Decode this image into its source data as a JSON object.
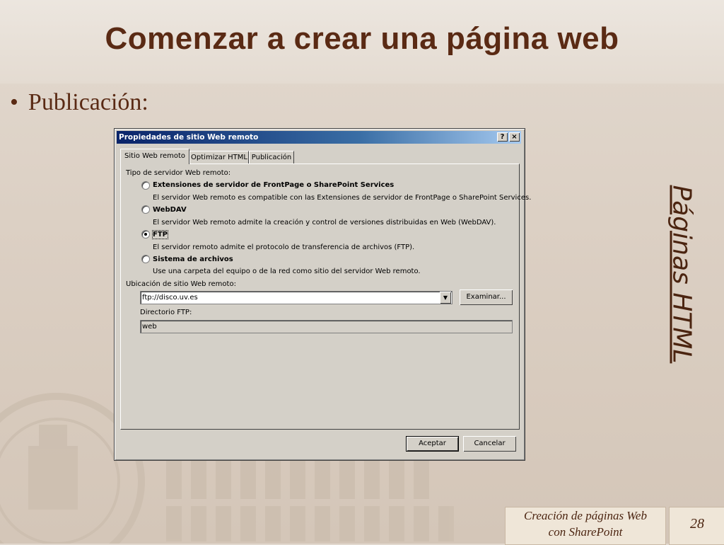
{
  "slide": {
    "title": "Comenzar a crear una página web",
    "bullet": "Publicación:",
    "side_title": "Páginas HTML",
    "footer_line1": "Creación de páginas Web",
    "footer_line2": "con SharePoint",
    "page_number": "28",
    "colors": {
      "title": "#5a2a14",
      "background": "#dcd0c4"
    }
  },
  "dialog": {
    "title": "Propiedades de sitio Web remoto",
    "help_btn": "?",
    "close_btn": "×",
    "tabs": [
      {
        "label": "Sitio Web remoto",
        "active": true
      },
      {
        "label": "Optimizar HTML",
        "active": false
      },
      {
        "label": "Publicación",
        "active": false
      }
    ],
    "server_type_label": "Tipo de servidor Web remoto:",
    "options": [
      {
        "label": "Extensiones de servidor de FrontPage o SharePoint Services",
        "desc": "El servidor Web remoto es compatible con las Extensiones de servidor de FrontPage o SharePoint Services.",
        "selected": false
      },
      {
        "label": "WebDAV",
        "desc": "El servidor Web remoto admite la creación y control de versiones distribuidas en Web (WebDAV).",
        "selected": false
      },
      {
        "label": "FTP",
        "desc": "El servidor remoto admite el protocolo de transferencia de archivos (FTP).",
        "selected": true
      },
      {
        "label": "Sistema de archivos",
        "desc": "Use una carpeta del equipo o de la red como sitio del servidor Web remoto.",
        "selected": false
      }
    ],
    "location_label": "Ubicación de sitio Web remoto:",
    "location_value": "ftp://disco.uv.es",
    "browse_button": "Examinar...",
    "ftp_dir_label": "Directorio FTP:",
    "ftp_dir_value": "web",
    "ok_button": "Aceptar",
    "cancel_button": "Cancelar"
  }
}
